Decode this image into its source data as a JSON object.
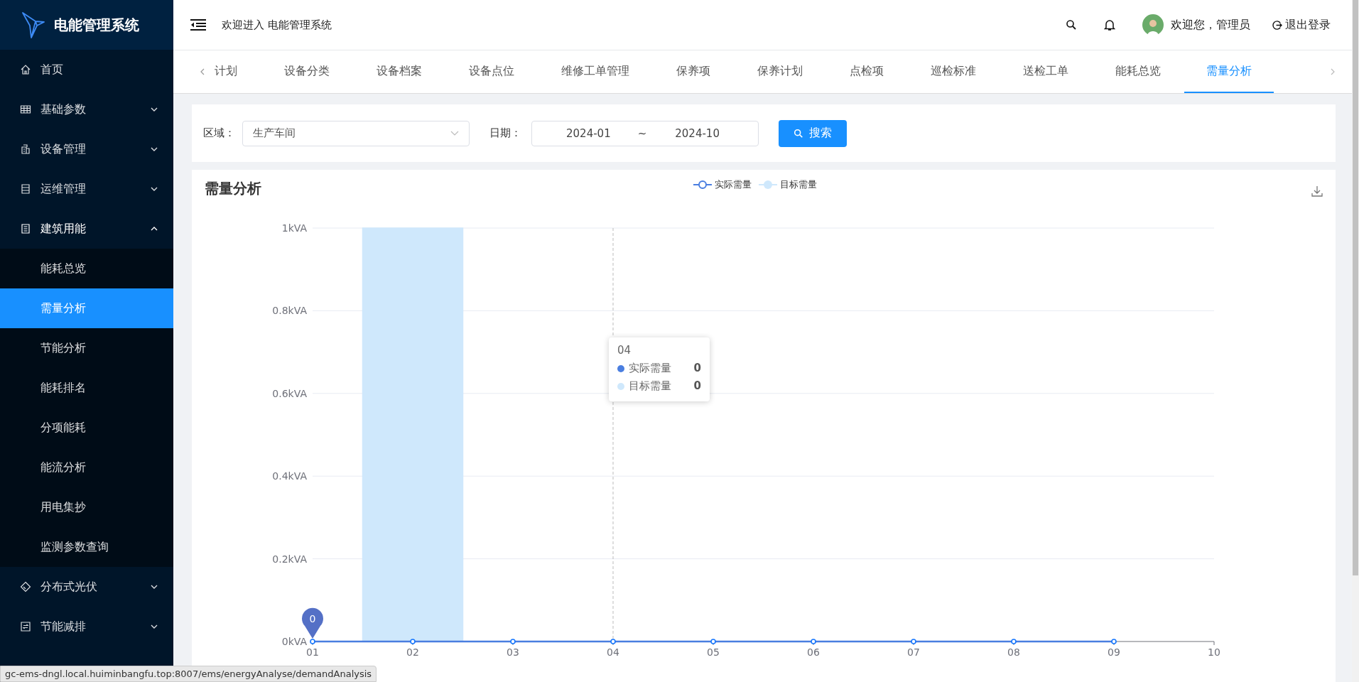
{
  "app": {
    "title": "电能管理系统"
  },
  "sidebar": {
    "items": [
      {
        "label": "首页",
        "kind": "link"
      },
      {
        "label": "基础参数",
        "kind": "submenu",
        "expanded": false
      },
      {
        "label": "设备管理",
        "kind": "submenu",
        "expanded": false
      },
      {
        "label": "运维管理",
        "kind": "submenu",
        "expanded": false
      },
      {
        "label": "建筑用能",
        "kind": "submenu",
        "expanded": true,
        "children": [
          {
            "label": "能耗总览",
            "selected": false
          },
          {
            "label": "需量分析",
            "selected": true
          },
          {
            "label": "节能分析",
            "selected": false
          },
          {
            "label": "能耗排名",
            "selected": false
          },
          {
            "label": "分项能耗",
            "selected": false
          },
          {
            "label": "能流分析",
            "selected": false
          },
          {
            "label": "用电集抄",
            "selected": false
          },
          {
            "label": "监测参数查询",
            "selected": false
          }
        ]
      },
      {
        "label": "分布式光伏",
        "kind": "submenu",
        "expanded": false
      },
      {
        "label": "节能减排",
        "kind": "submenu",
        "expanded": false
      }
    ]
  },
  "header": {
    "greeting": "欢迎进入 电能管理系统",
    "user": "欢迎您，管理员",
    "logout": "退出登录"
  },
  "tabs": [
    {
      "label": "计划",
      "selected": false
    },
    {
      "label": "设备分类",
      "selected": false
    },
    {
      "label": "设备档案",
      "selected": false
    },
    {
      "label": "设备点位",
      "selected": false
    },
    {
      "label": "维修工单管理",
      "selected": false
    },
    {
      "label": "保养项",
      "selected": false
    },
    {
      "label": "保养计划",
      "selected": false
    },
    {
      "label": "点检项",
      "selected": false
    },
    {
      "label": "巡检标准",
      "selected": false
    },
    {
      "label": "送检工单",
      "selected": false
    },
    {
      "label": "能耗总览",
      "selected": false
    },
    {
      "label": "需量分析",
      "selected": true
    }
  ],
  "filter": {
    "area_label": "区域：",
    "area_value": "生产车间",
    "date_label": "日期：",
    "date_start": "2024-01",
    "date_separator": "~",
    "date_end": "2024-10",
    "search_button": "搜索"
  },
  "chart_section": {
    "title": "需量分析",
    "chart_data": {
      "type": "line",
      "categories": [
        "01",
        "02",
        "03",
        "04",
        "05",
        "06",
        "07",
        "08",
        "09",
        "10"
      ],
      "series": [
        {
          "name": "实际需量",
          "color": "#4a7ee0",
          "marker": "circle",
          "values": [
            0,
            0,
            0,
            0,
            0,
            0,
            0,
            0,
            0,
            null
          ]
        },
        {
          "name": "目标需量",
          "type": "bar",
          "color": "#cfe8fc",
          "values": [
            0,
            1,
            0,
            0,
            0,
            0,
            0,
            0,
            0,
            null
          ]
        }
      ],
      "grid": true,
      "legend": "top",
      "ref_lines": [
        {
          "axis": "x",
          "value": "04"
        }
      ],
      "ylim": [
        0,
        1
      ],
      "yticks": [
        {
          "value": 0,
          "label": "0kVA"
        },
        {
          "value": 0.2,
          "label": "0.2kVA"
        },
        {
          "value": 0.4,
          "label": "0.4kVA"
        },
        {
          "value": 0.6,
          "label": "0.6kVA"
        },
        {
          "value": 0.8,
          "label": "0.8kVA"
        },
        {
          "value": 1,
          "label": "1kVA"
        }
      ],
      "annotations": [
        {
          "x": "01",
          "y": 0,
          "text": "0"
        }
      ]
    },
    "tooltip": {
      "title": "04",
      "rows": [
        {
          "name": "实际需量",
          "value": "0"
        },
        {
          "name": "目标需量",
          "value": "0"
        }
      ]
    }
  },
  "status_bar": {
    "url": "gc-ems-dngl.local.huiminbangfu.top:8007/ems/energyAnalyse/demandAnalysis"
  }
}
